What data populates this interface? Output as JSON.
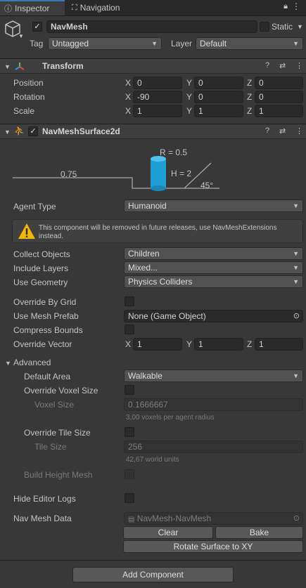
{
  "tabs": [
    {
      "label": "Inspector",
      "icon": "info-icon"
    },
    {
      "label": "Navigation",
      "icon": "compass-icon"
    }
  ],
  "gameobject": {
    "active": true,
    "name": "NavMesh",
    "static_label": "Static",
    "static": false,
    "tag_label": "Tag",
    "tag_value": "Untagged",
    "layer_label": "Layer",
    "layer_value": "Default"
  },
  "transform": {
    "title": "Transform",
    "rows": [
      {
        "label": "Position",
        "x": "0",
        "y": "0",
        "z": "0"
      },
      {
        "label": "Rotation",
        "x": "-90",
        "y": "0",
        "z": "0"
      },
      {
        "label": "Scale",
        "x": "1",
        "y": "1",
        "z": "1"
      }
    ]
  },
  "axes": {
    "x": "X",
    "y": "Y",
    "z": "Z"
  },
  "navmesh": {
    "title": "NavMeshSurface2d",
    "enabled": true,
    "diagram": {
      "radius": "R = 0.5",
      "height": "H = 2",
      "step": "0.75",
      "slope": "45°"
    },
    "agent_type_label": "Agent Type",
    "agent_type": "Humanoid",
    "warning": "This component will be removed in future releases, use NavMeshExtensions instead.",
    "collect_objects_label": "Collect Objects",
    "collect_objects": "Children",
    "include_layers_label": "Include Layers",
    "include_layers": "Mixed...",
    "use_geometry_label": "Use Geometry",
    "use_geometry": "Physics Colliders",
    "override_by_grid_label": "Override By Grid",
    "use_mesh_prefab_label": "Use Mesh Prefab",
    "use_mesh_prefab": "None (Game Object)",
    "compress_bounds_label": "Compress Bounds",
    "override_vector_label": "Override Vector",
    "override_vector": {
      "x": "1",
      "y": "1",
      "z": "1"
    },
    "advanced_label": "Advanced",
    "default_area_label": "Default Area",
    "default_area": "Walkable",
    "override_voxel_label": "Override Voxel Size",
    "voxel_size_label": "Voxel Size",
    "voxel_size": "0.1666667",
    "voxel_hint": "3,00 voxels per agent radius",
    "override_tile_label": "Override Tile Size",
    "tile_size_label": "Tile Size",
    "tile_size": "256",
    "tile_hint": "42,67 world units",
    "build_height_label": "Build Height Mesh",
    "hide_logs_label": "Hide Editor Logs",
    "nav_mesh_data_label": "Nav Mesh Data",
    "nav_mesh_data": "NavMesh-NavMesh",
    "clear_label": "Clear",
    "bake_label": "Bake",
    "rotate_label": "Rotate Surface to XY"
  },
  "add_component_label": "Add Component",
  "colors": {
    "accent": "#3a79bb",
    "cylinder": "#1e9fd6",
    "warning": "#f2b705"
  }
}
